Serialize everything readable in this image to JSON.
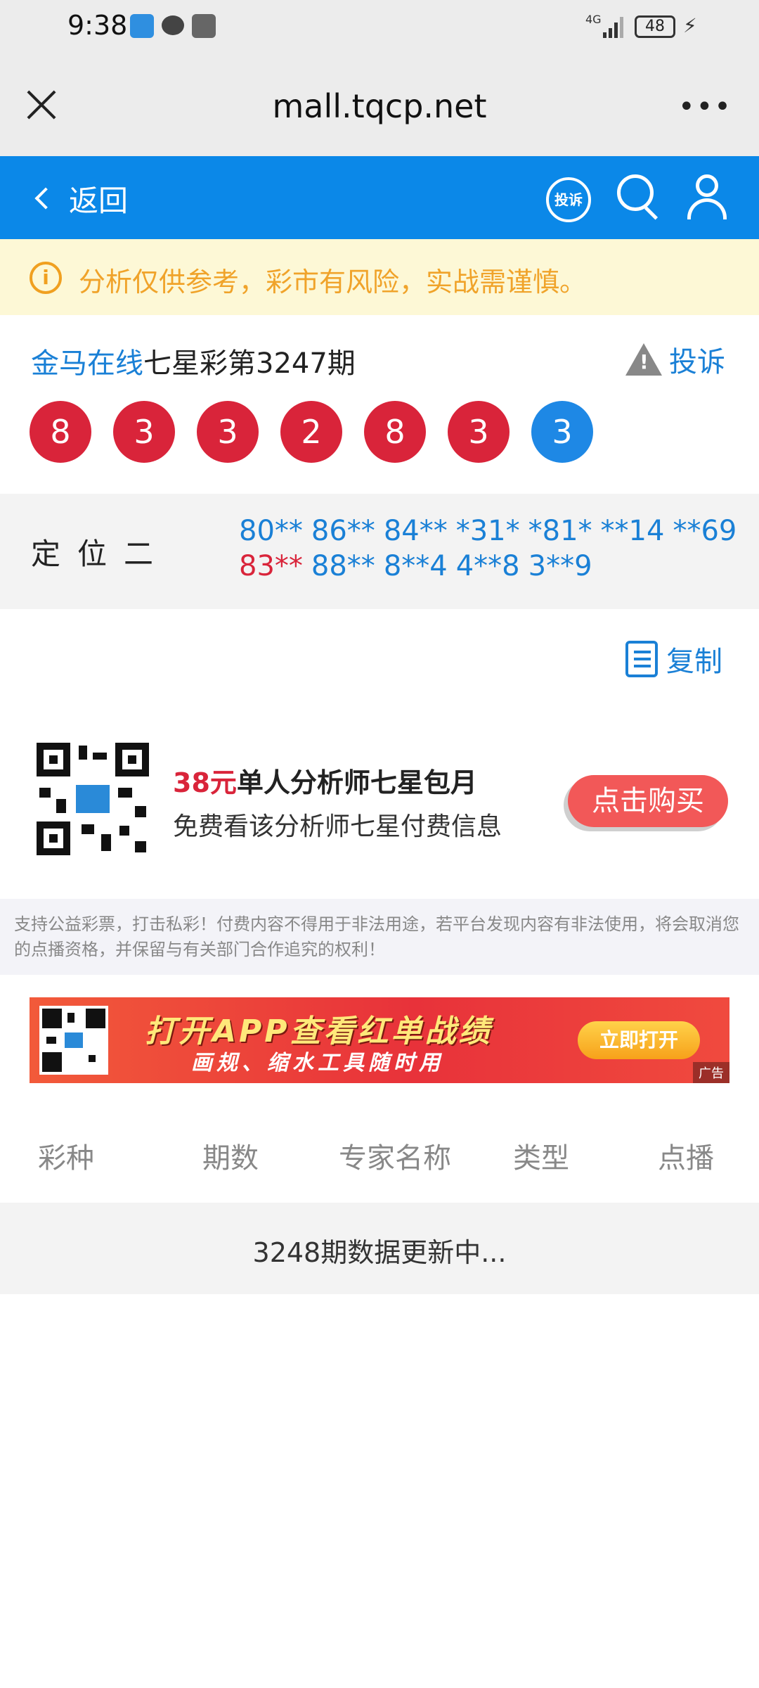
{
  "status": {
    "time": "9:38",
    "network": "4G",
    "battery": "48"
  },
  "browser": {
    "url": "mall.tqcp.net",
    "more": "•••"
  },
  "header": {
    "back": "返回",
    "complain_badge": "投诉"
  },
  "warning": {
    "text": "分析仅供参考，彩市有风险，实战需谨慎。"
  },
  "draw": {
    "site": "金马在线",
    "name": "七星彩第3247期",
    "complain": "投诉",
    "balls": [
      {
        "value": "8",
        "color": "red"
      },
      {
        "value": "3",
        "color": "red"
      },
      {
        "value": "3",
        "color": "red"
      },
      {
        "value": "2",
        "color": "red"
      },
      {
        "value": "8",
        "color": "red"
      },
      {
        "value": "3",
        "color": "red"
      },
      {
        "value": "3",
        "color": "blue"
      }
    ]
  },
  "position": {
    "label": "定位二",
    "line1": [
      "80**",
      "86**",
      "84**",
      "*31*",
      "*81*",
      "**14",
      "**69"
    ],
    "line2_red": "83**",
    "line2": [
      "88**",
      "8**4",
      "4**8",
      "3**9"
    ]
  },
  "copy": {
    "label": "复制"
  },
  "promo": {
    "price": "38元",
    "title_rest": "单人分析师七星包月",
    "subtitle": "免费看该分析师七星付费信息",
    "button": "点击购买"
  },
  "disclaimer": "支持公益彩票，打击私彩！付费内容不得用于非法用途，若平台发现内容有非法使用，将会取消您的点播资格，并保留与有关部门合作追究的权利！",
  "banner": {
    "title": "打开APP查看红单战绩",
    "subtitle": "画规、缩水工具随时用",
    "button": "立即打开",
    "ad_tag": "广告"
  },
  "table": {
    "columns": [
      "彩种",
      "期数",
      "专家名称",
      "类型",
      "点播"
    ],
    "update": "3248期数据更新中..."
  },
  "colors": {
    "blue": "#0b88e8",
    "red": "#d9243a",
    "warning": "#f0a32a"
  }
}
